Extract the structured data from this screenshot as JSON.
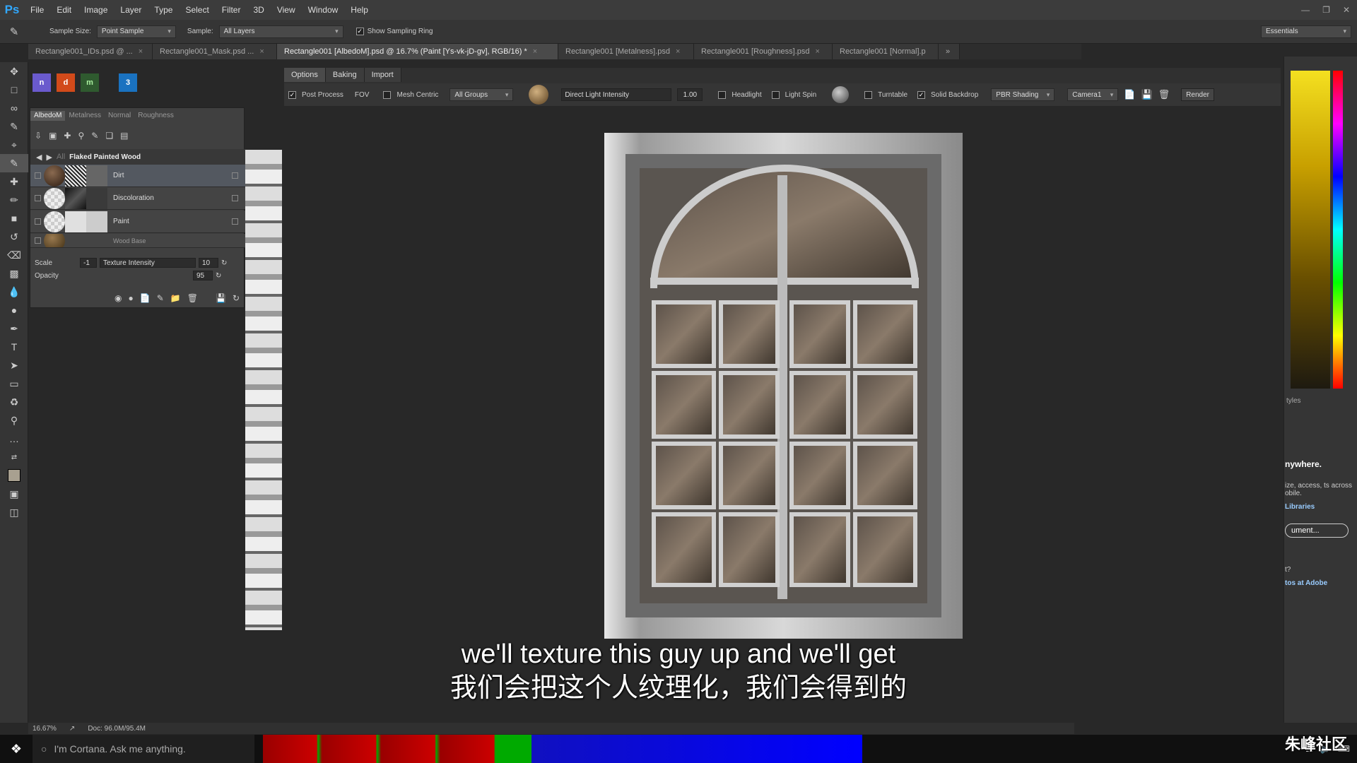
{
  "app": {
    "logo": "Ps"
  },
  "menu": [
    "File",
    "Edit",
    "Image",
    "Layer",
    "Type",
    "Select",
    "Filter",
    "3D",
    "View",
    "Window",
    "Help"
  ],
  "options_bar": {
    "sample_size_label": "Sample Size:",
    "sample_size_value": "Point Sample",
    "sample_label": "Sample:",
    "sample_value": "All Layers",
    "show_sampling_ring": "Show Sampling Ring",
    "workspace": "Essentials"
  },
  "doc_tabs": [
    {
      "label": "Rectangle001_IDs.psd @ ...",
      "active": false
    },
    {
      "label": "Rectangle001_Mask.psd ...",
      "active": false
    },
    {
      "label": "Rectangle001 [AlbedoM].psd @ 16.7% (Paint [Ys-vk-jD-gv], RGB/16) *",
      "active": true
    },
    {
      "label": "Rectangle001 [Metalness].psd",
      "active": false
    },
    {
      "label": "Rectangle001 [Roughness].psd",
      "active": false
    },
    {
      "label": "Rectangle001 [Normal].p",
      "active": false
    }
  ],
  "plugin": {
    "tabs": [
      "Options",
      "Baking",
      "Import"
    ],
    "post_process": "Post Process",
    "fov": "FOV",
    "mesh_centric": "Mesh Centric",
    "all_groups": "All Groups",
    "light_field": "Direct Light Intensity",
    "light_value": "1.00",
    "headlight": "Headlight",
    "light_spin": "Light Spin",
    "turntable": "Turntable",
    "solid_backdrop": "Solid Backdrop",
    "pbr_shading": "PBR Shading",
    "camera": "Camera1",
    "render": "Render"
  },
  "material_panel": {
    "tabs": [
      "AlbedoM",
      "Metalness",
      "Normal",
      "Roughness"
    ],
    "breadcrumb": "All",
    "material_name": "Flaked Painted Wood",
    "layers": [
      {
        "name": "Dirt",
        "active": true
      },
      {
        "name": "Discoloration",
        "active": false
      },
      {
        "name": "Paint",
        "active": false
      },
      {
        "name": "Wood Base",
        "active": false
      }
    ],
    "scale_label": "Scale",
    "scale_value": "-1",
    "texture_intensity_label": "Texture Intensity",
    "texture_intensity_value": "10",
    "opacity_label": "Opacity",
    "opacity_value": "95"
  },
  "right_panel": {
    "styles": "tyles",
    "anywhere": "nywhere.",
    "desc": "ize, access, ts across obile.",
    "libraries": "Libraries",
    "document_btn": "ument...",
    "q": "t?",
    "adobe_link": "tos at Adobe"
  },
  "subtitles": {
    "en": "we'll texture this guy up and we'll get",
    "zh": "我们会把这个人纹理化，我们会得到的"
  },
  "status": {
    "zoom": "16.67%",
    "doc": "Doc: 96.0M/95.4M"
  },
  "taskbar": {
    "cortana": "I'm Cortana. Ask me anything."
  },
  "watermark": "朱峰社区",
  "colors": {
    "accent": "#31a8ff",
    "panel": "#404040",
    "canvas": "#282828"
  }
}
